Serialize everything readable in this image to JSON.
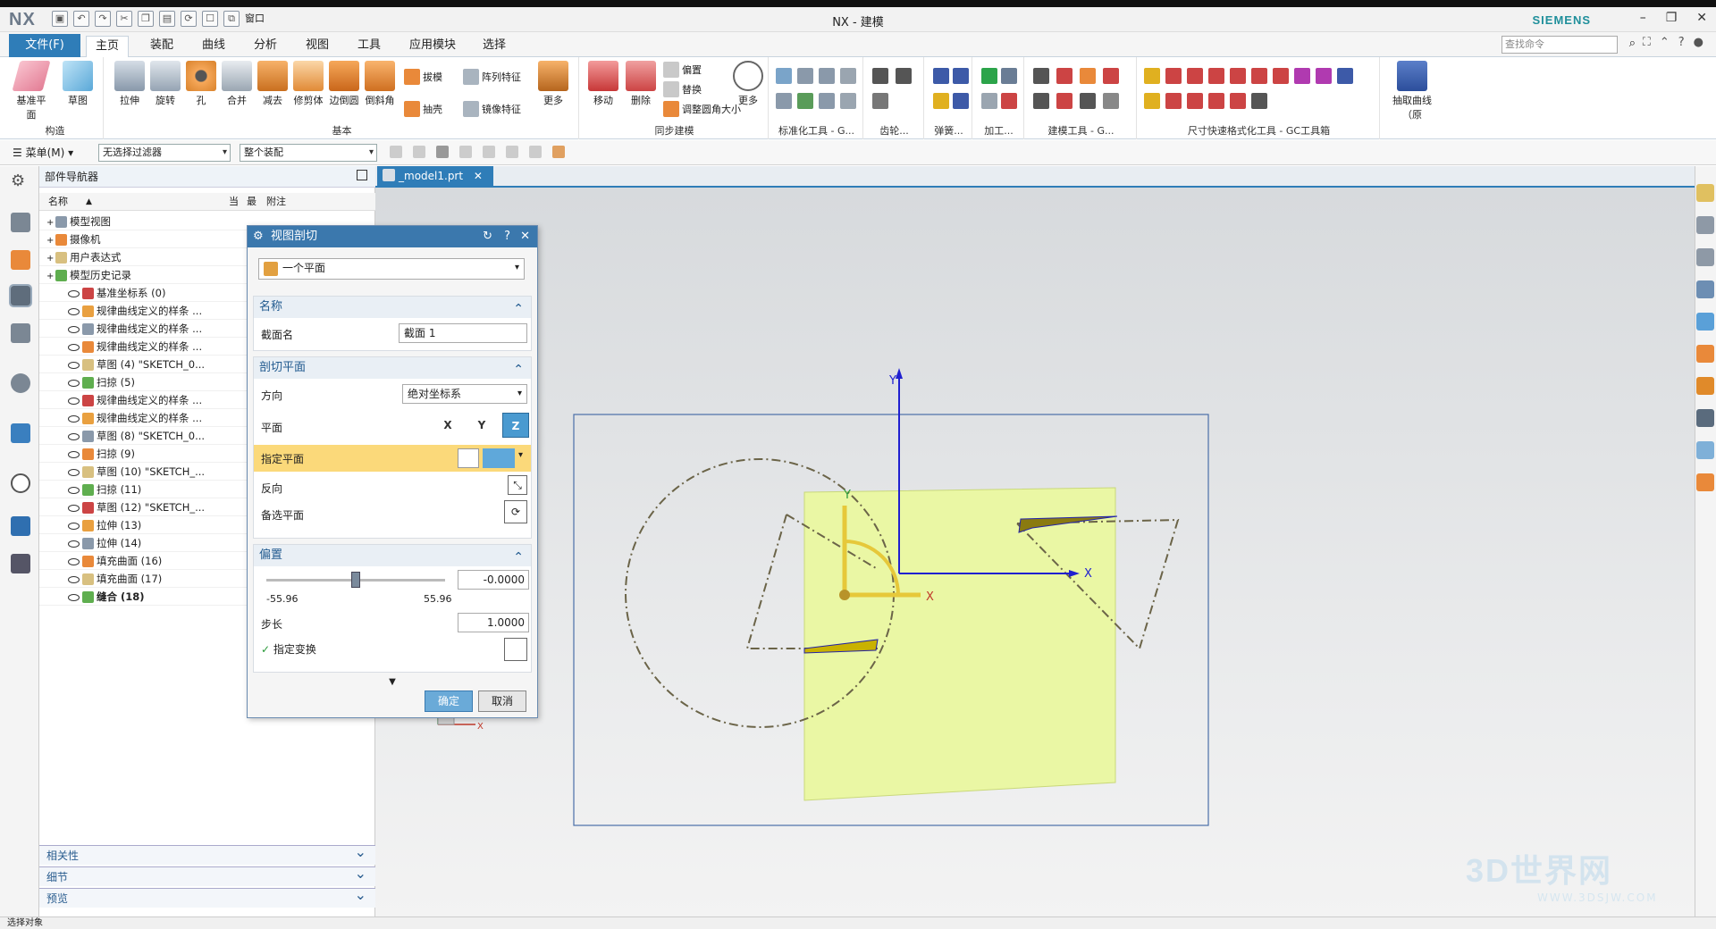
{
  "window": {
    "logo": "NX",
    "title": "NX - 建模",
    "brand": "SIEMENS",
    "view_combo": "窗口"
  },
  "tabs": [
    "文件(F)",
    "主页",
    "装配",
    "曲线",
    "分析",
    "视图",
    "工具",
    "应用模块",
    "选择"
  ],
  "search": {
    "placeholder": "查找命令"
  },
  "ribbon": {
    "construct": {
      "label": "构造",
      "buttons": [
        "基准平面",
        "草图"
      ]
    },
    "basic": {
      "label": "基本",
      "buttons": [
        "拉伸",
        "旋转",
        "孔",
        "合并",
        "减去",
        "修剪体",
        "边倒圆",
        "倒斜角"
      ],
      "small": [
        "拔模",
        "抽壳",
        "阵列特征",
        "镜像特征"
      ],
      "more": "更多"
    },
    "sync": {
      "label": "同步建模",
      "buttons": [
        "移动",
        "删除"
      ],
      "small": [
        "偏置",
        "替换",
        "调整圆角大小"
      ],
      "more": "更多"
    },
    "groups": [
      "标准化工具 - G...",
      "齿轮...",
      "弹簧...",
      "加工...",
      "建模工具 - G...",
      "尺寸快速格式化工具 - GC工具箱"
    ],
    "extract": "抽取曲线（原"
  },
  "toolbar2": {
    "menu": "菜单(M)",
    "filter": "无选择过滤器",
    "scope": "整个装配"
  },
  "navigator": {
    "title": "部件导航器",
    "columns": [
      "名称",
      "当",
      "最",
      "附注"
    ],
    "rows": [
      {
        "label": "模型视图",
        "indent": 1,
        "bold": false
      },
      {
        "label": "摄像机",
        "indent": 1,
        "bold": false
      },
      {
        "label": "用户表达式",
        "indent": 1,
        "bold": false
      },
      {
        "label": "模型历史记录",
        "indent": 1,
        "bold": false
      },
      {
        "label": "基准坐标系 (0)",
        "indent": 2,
        "bold": false
      },
      {
        "label": "规律曲线定义的样条 ...",
        "indent": 2,
        "bold": false
      },
      {
        "label": "规律曲线定义的样条 ...",
        "indent": 2,
        "bold": false
      },
      {
        "label": "规律曲线定义的样条 ...",
        "indent": 2,
        "bold": false
      },
      {
        "label": "草图 (4) \"SKETCH_0...",
        "indent": 2,
        "bold": false
      },
      {
        "label": "扫掠 (5)",
        "indent": 2,
        "bold": false
      },
      {
        "label": "规律曲线定义的样条 ...",
        "indent": 2,
        "bold": false
      },
      {
        "label": "规律曲线定义的样条 ...",
        "indent": 2,
        "bold": false
      },
      {
        "label": "草图 (8) \"SKETCH_0...",
        "indent": 2,
        "bold": false
      },
      {
        "label": "扫掠 (9)",
        "indent": 2,
        "bold": false
      },
      {
        "label": "草图 (10) \"SKETCH_...",
        "indent": 2,
        "bold": false
      },
      {
        "label": "扫掠 (11)",
        "indent": 2,
        "bold": false
      },
      {
        "label": "草图 (12) \"SKETCH_...",
        "indent": 2,
        "bold": false
      },
      {
        "label": "拉伸 (13)",
        "indent": 2,
        "bold": false
      },
      {
        "label": "拉伸 (14)",
        "indent": 2,
        "bold": false
      },
      {
        "label": "填充曲面 (16)",
        "indent": 2,
        "bold": false
      },
      {
        "label": "填充曲面 (17)",
        "indent": 2,
        "bold": false
      },
      {
        "label": "缝合 (18)",
        "indent": 2,
        "bold": true
      }
    ],
    "bottom": [
      "相关性",
      "细节",
      "预览"
    ]
  },
  "doc_tab": "_model1.prt",
  "dialog": {
    "title": "视图剖切",
    "type": "一个平面",
    "name_section": "名称",
    "name_label": "截面名",
    "name_value": "截面 1",
    "plane_section": "剖切平面",
    "direction_label": "方向",
    "direction_value": "绝对坐标系",
    "plane_label": "平面",
    "specify_plane": "指定平面",
    "reverse": "反向",
    "alternate": "备选平面",
    "offset_section": "偏置",
    "offset_value": "-0.0000",
    "slider_min": "-55.96",
    "slider_max": "55.96",
    "slider_fraction": 0.5,
    "step_label": "步长",
    "step_value": "1.0000",
    "specify_transform": "指定变换",
    "ok": "确定",
    "cancel": "取消"
  },
  "axes": {
    "x": "X",
    "y": "Y"
  },
  "status": "选择对象",
  "watermark": {
    "text": "3D世界网",
    "sub": "WWW.3DSJW.COM"
  },
  "colors": {
    "accent": "#2f7db8",
    "highlight": "#fbd97a",
    "plane": "#eaf7a4"
  }
}
